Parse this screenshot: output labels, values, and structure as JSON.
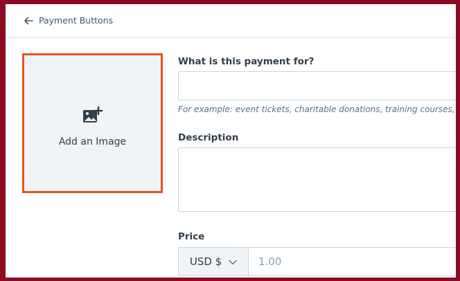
{
  "header": {
    "back_label": "Payment Buttons",
    "back_icon": "arrow-left-icon"
  },
  "image_uploader": {
    "label": "Add an Image",
    "icon": "add-image-icon"
  },
  "form": {
    "payment_for": {
      "label": "What is this payment for?",
      "value": "",
      "hint": "For example: event tickets, charitable donations, training courses,"
    },
    "description": {
      "label": "Description",
      "value": ""
    },
    "price": {
      "label": "Price",
      "currency": "USD $",
      "currency_icon": "chevron-down-icon",
      "placeholder": "1.00"
    }
  },
  "colors": {
    "outer_border": "#8b0a24",
    "image_box_border": "#e8531e",
    "image_box_bg": "#f1f4f7",
    "text": "#333e48",
    "muted": "#5a7185"
  }
}
